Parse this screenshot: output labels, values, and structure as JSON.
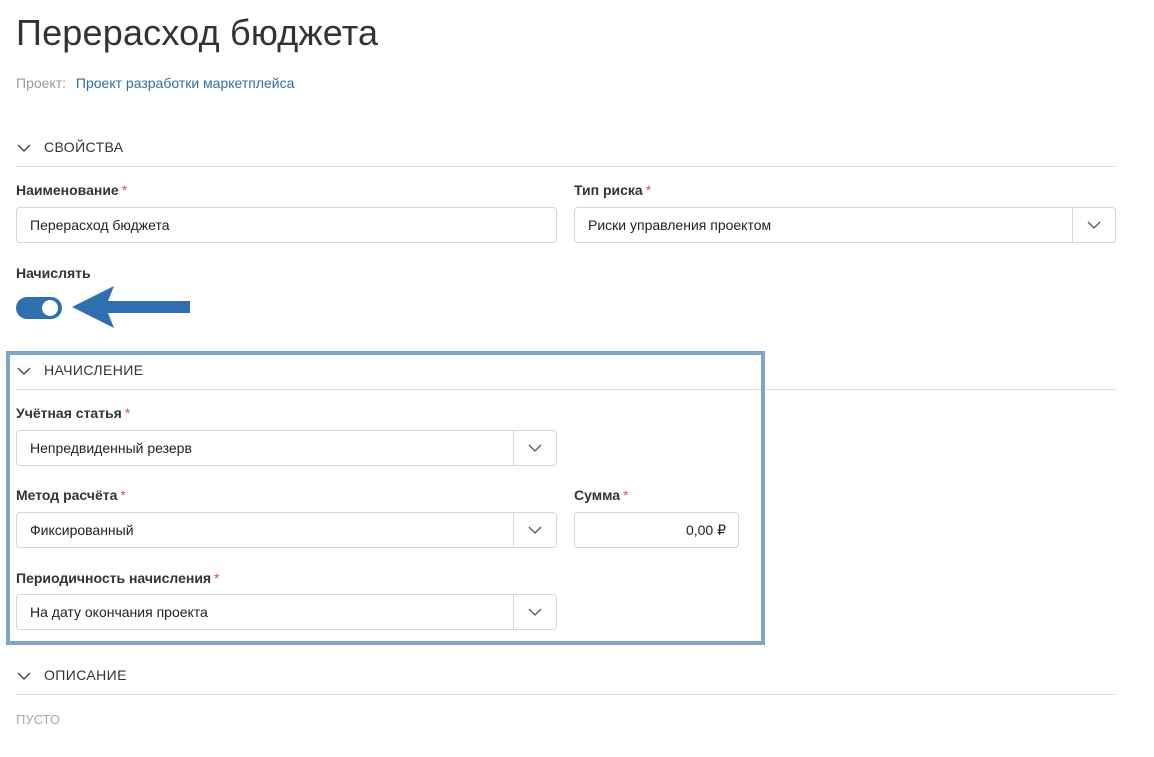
{
  "page": {
    "title": "Перерасход бюджета",
    "project_label": "Проект:",
    "project_name": "Проект разработки маркетплейса"
  },
  "sections": {
    "properties": {
      "title": "СВОЙСТВА",
      "name": {
        "label": "Наименование",
        "required": "*",
        "value": "Перерасход бюджета"
      },
      "risk_type": {
        "label": "Тип риска",
        "required": "*",
        "value": "Риски управления проектом"
      },
      "accrue": {
        "label": "Начислять",
        "enabled": true
      }
    },
    "accrual": {
      "title": "НАЧИСЛЕНИЕ",
      "account_item": {
        "label": "Учётная статья",
        "required": "*",
        "value": "Непредвиденный резерв"
      },
      "calc_method": {
        "label": "Метод расчёта",
        "required": "*",
        "value": "Фиксированный"
      },
      "amount": {
        "label": "Сумма",
        "required": "*",
        "value": "0,00 ₽"
      },
      "periodicity": {
        "label": "Периодичность начисления",
        "required": "*",
        "value": "На дату окончания проекта"
      }
    },
    "description": {
      "title": "ОПИСАНИЕ",
      "empty_text": "ПУСТО"
    }
  },
  "icons": {
    "collapse": "chevron-down-icon",
    "dropdown": "chevron-down-icon",
    "annotation": "arrow-left-icon"
  },
  "colors": {
    "accent": "#2f6fb0",
    "link": "#2f6fa6",
    "required": "#d9534f",
    "highlight": "#7ea6c9"
  }
}
